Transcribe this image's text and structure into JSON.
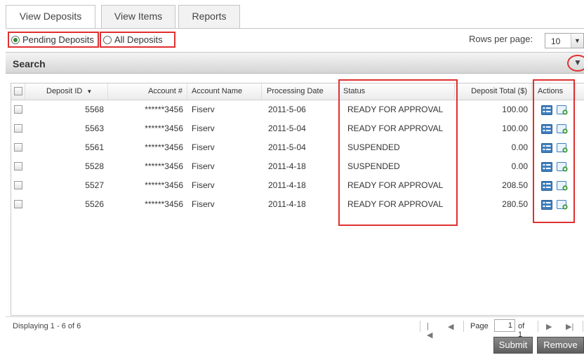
{
  "tabs": [
    {
      "label": "View Deposits"
    },
    {
      "label": "View Items"
    },
    {
      "label": "Reports"
    }
  ],
  "filters": {
    "pending_label": "Pending Deposits",
    "all_label": "All Deposits",
    "selected": "pending"
  },
  "rows_per_page": {
    "label": "Rows per page:",
    "value": "10"
  },
  "search": {
    "title": "Search"
  },
  "grid": {
    "columns": [
      "Deposit ID",
      "Account #",
      "Account Name",
      "Processing Date",
      "Status",
      "Deposit Total ($)",
      "Actions"
    ],
    "rows": [
      {
        "deposit_id": "5568",
        "account": "******3456",
        "account_name": "Fiserv",
        "date": "2011-5-06",
        "status": "READY FOR APPROVAL",
        "total": "100.00"
      },
      {
        "deposit_id": "5563",
        "account": "******3456",
        "account_name": "Fiserv",
        "date": "2011-5-04",
        "status": "READY FOR APPROVAL",
        "total": "100.00"
      },
      {
        "deposit_id": "5561",
        "account": "******3456",
        "account_name": "Fiserv",
        "date": "2011-5-04",
        "status": "SUSPENDED",
        "total": "0.00"
      },
      {
        "deposit_id": "5528",
        "account": "******3456",
        "account_name": "Fiserv",
        "date": "2011-4-18",
        "status": "SUSPENDED",
        "total": "0.00"
      },
      {
        "deposit_id": "5527",
        "account": "******3456",
        "account_name": "Fiserv",
        "date": "2011-4-18",
        "status": "READY FOR APPROVAL",
        "total": "208.50"
      },
      {
        "deposit_id": "5526",
        "account": "******3456",
        "account_name": "Fiserv",
        "date": "2011-4-18",
        "status": "READY FOR APPROVAL",
        "total": "280.50"
      }
    ]
  },
  "footer": {
    "displaying": "Displaying 1 - 6 of 6",
    "page_label": "Page",
    "page_value": "1",
    "of_label": "of 1"
  },
  "buttons": {
    "submit": "Submit",
    "remove": "Remove"
  },
  "colors": {
    "highlight": "#e03030",
    "radio_selected": "#2e8b2e",
    "action_icon_blue": "#3f7fc0",
    "action_icon_green": "#3a9a3a"
  },
  "icons": {
    "sort": "sort-desc-icon",
    "detail_action": "detail-view-icon",
    "add_action": "add-item-icon"
  }
}
